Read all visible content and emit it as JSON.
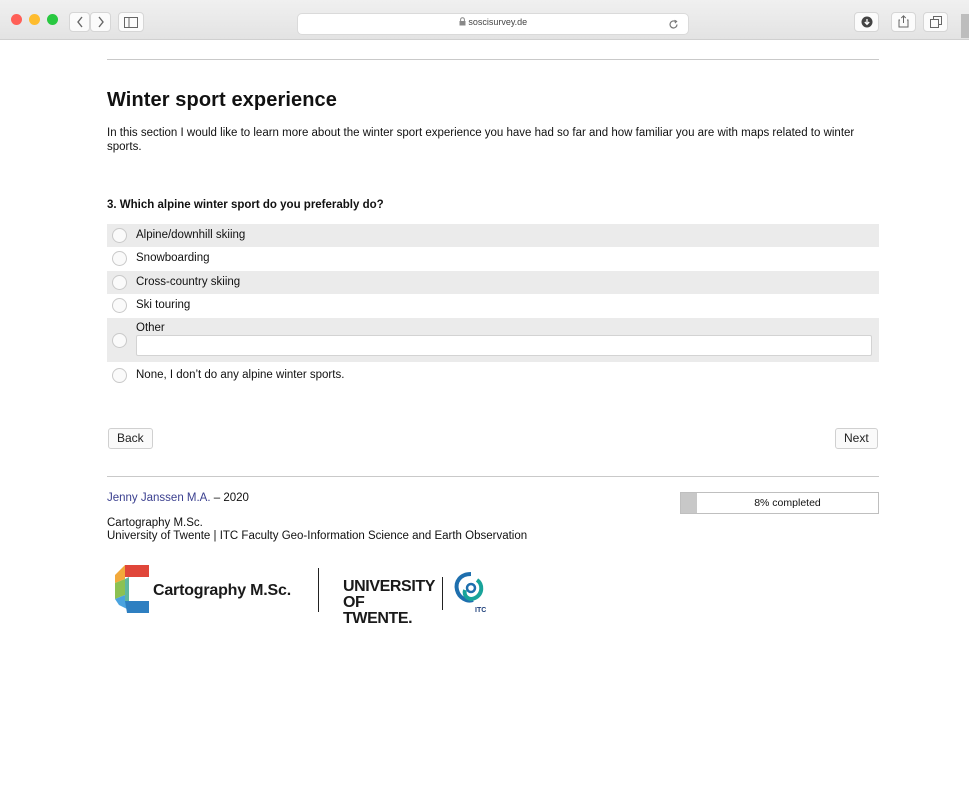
{
  "browser": {
    "url": "soscisurvey.de",
    "lock_icon": "lock-icon",
    "nav_back_icon": "chevron-left-icon",
    "nav_forward_icon": "chevron-right-icon",
    "sidebar_icon": "sidebar-icon",
    "reload_icon": "reload-icon",
    "download_icon": "download-icon",
    "share_icon": "share-icon",
    "tabs_icon": "tabs-icon"
  },
  "page": {
    "title": "Winter sport experience",
    "intro": "In this section I would like to learn more about the winter sport experience you have had so far and how familiar you are with maps related to winter sports.",
    "question": "3. Which alpine winter sport do you preferably do?",
    "options": [
      {
        "label": "Alpine/downhill skiing"
      },
      {
        "label": "Snowboarding"
      },
      {
        "label": "Cross-country skiing"
      },
      {
        "label": "Ski touring"
      },
      {
        "label": "Other",
        "text_value": ""
      },
      {
        "label": "None, I don’t do any alpine winter sports."
      }
    ],
    "back_label": "Back",
    "next_label": "Next"
  },
  "footer": {
    "author_name": "Jenny Janssen M.A.",
    "author_year": " – 2020",
    "program_line1": "Cartography M.Sc.",
    "program_line2": "University of Twente | ITC Faculty Geo-Information Science and Earth Observation",
    "progress_text": "8% completed",
    "progress_fraction": 0.08,
    "logo_carto_text": "Cartography M.Sc.",
    "logo_ut_line1": "UNIVERSITY",
    "logo_ut_line2": "OF TWENTE.",
    "logo_itc_text": "ITC"
  },
  "colors": {
    "author_link": "#3a3f8f",
    "option_shade": "#ebebeb",
    "progress_fill": "#c8c8c8"
  }
}
